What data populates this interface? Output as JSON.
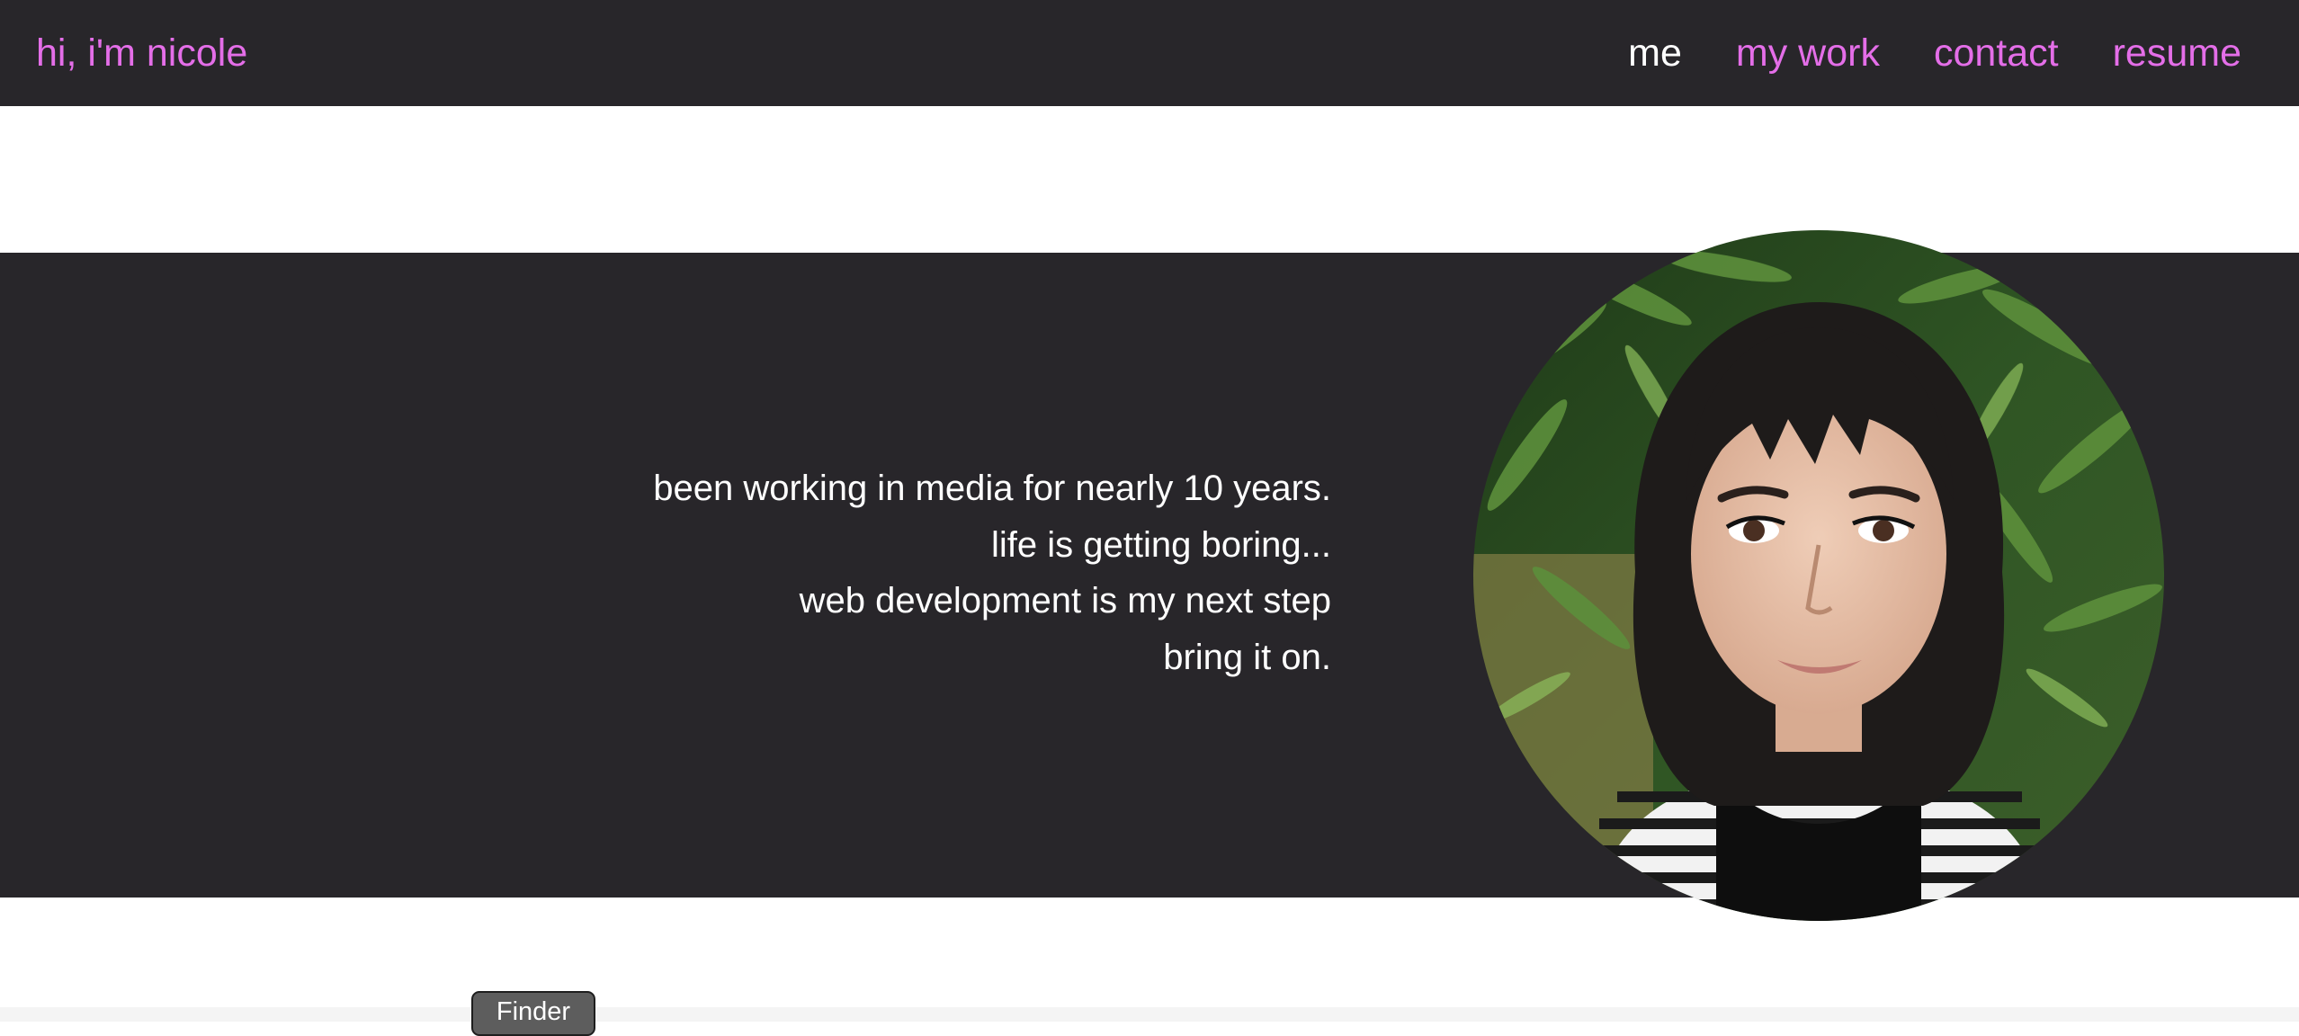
{
  "header": {
    "brand": "hi, i'm nicole",
    "nav": [
      {
        "label": "me",
        "active": true
      },
      {
        "label": "my work",
        "active": false
      },
      {
        "label": "contact",
        "active": false
      },
      {
        "label": "resume",
        "active": false
      }
    ]
  },
  "hero": {
    "lines": [
      "been working in media for nearly 10 years.",
      "life is getting boring...",
      "web development is my next step",
      "bring it on."
    ],
    "portrait_alt": "portrait photo"
  },
  "dock": {
    "tooltip": "Finder"
  },
  "colors": {
    "background_dark": "#28262a",
    "accent_pink": "#e46ee8",
    "text_light": "#ffffff"
  }
}
